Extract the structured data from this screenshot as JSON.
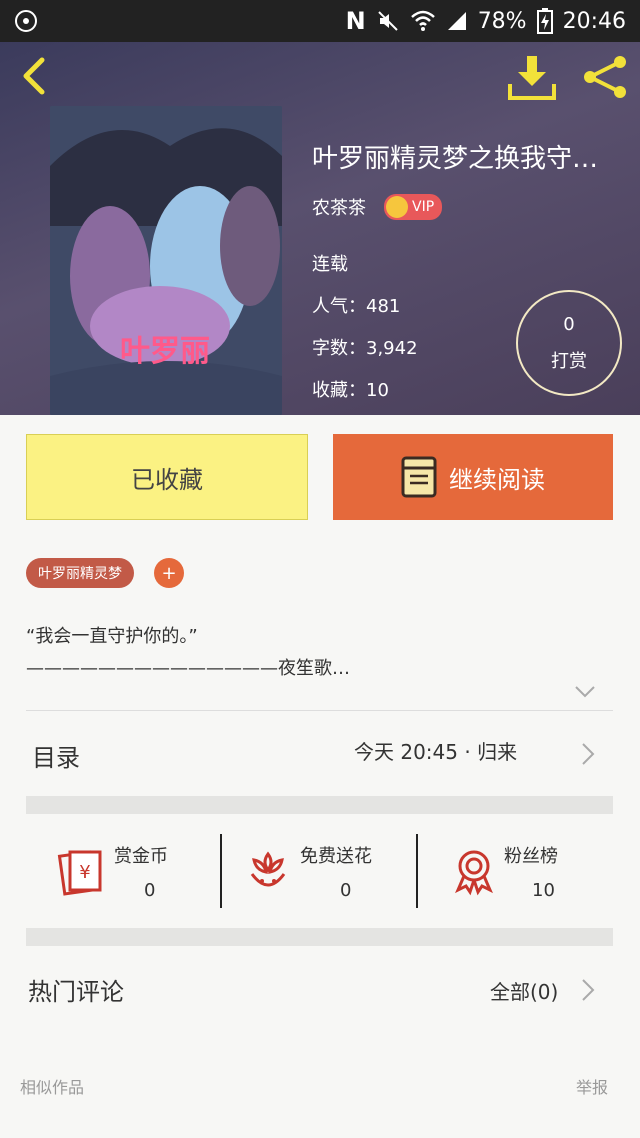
{
  "status_bar": {
    "battery": "78%",
    "time": "20:46"
  },
  "book": {
    "title": "叶罗丽精灵梦之换我守…",
    "author": "农茶茶",
    "vip_label": "VIP",
    "cover_logo": "叶罗丽",
    "status": "连载",
    "popularity": "人气：481",
    "word_count": "字数：3,942",
    "favorites": "收藏：10"
  },
  "tip": {
    "count": "0",
    "label": "打赏"
  },
  "actions": {
    "collected_label": "已收藏",
    "continue_label": "继续阅读"
  },
  "tag": {
    "label": "叶罗丽精灵梦",
    "add": "+"
  },
  "description": {
    "line1": "“我会一直守护你的。”",
    "line2": "——————————————夜笙歌…"
  },
  "toc": {
    "label": "目录",
    "latest": "今天  20:45  ·  归来"
  },
  "stats": [
    {
      "label": "赏金币",
      "value": "0"
    },
    {
      "label": "免费送花",
      "value": "0"
    },
    {
      "label": "粉丝榜",
      "value": "10"
    }
  ],
  "comments": {
    "label": "热门评论",
    "all": "全部(0)"
  },
  "footer": {
    "similar": "相似作品",
    "report": "举报"
  },
  "colors": {
    "accent_orange": "#e5693b",
    "collect_yellow": "#fbf283",
    "tag_red": "#c25a47",
    "icon_red": "#c8372d",
    "nav_yellow": "#f2e13a"
  },
  "icons": [
    "back-arrow-icon",
    "download-icon",
    "share-icon",
    "book-icon",
    "red-envelope-icon",
    "flower-icon",
    "medal-icon",
    "chevron-right-icon",
    "chevron-down-icon"
  ]
}
